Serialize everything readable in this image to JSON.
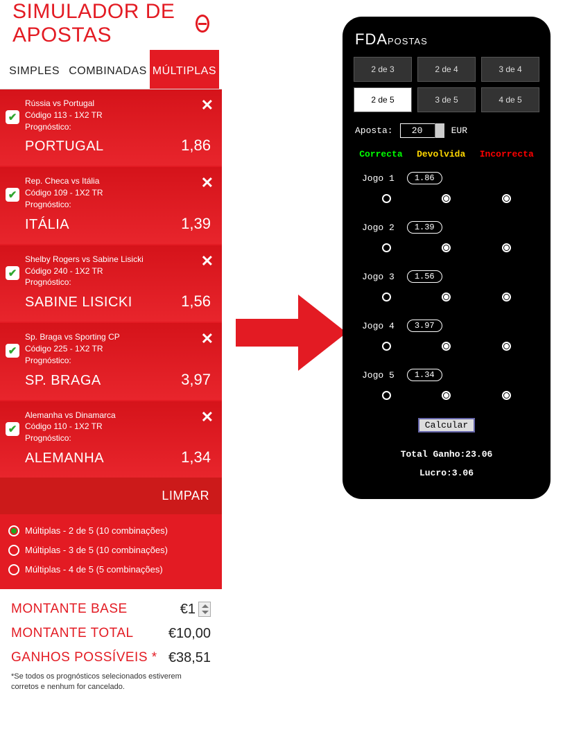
{
  "left": {
    "title": "SIMULADOR DE APOSTAS",
    "tabs": [
      "SIMPLES",
      "COMBINADAS",
      "MÚLTIPLAS"
    ],
    "picks": [
      {
        "match": "Rússia vs Portugal",
        "code": "Código 113 - 1X2 TR",
        "prog": "Prognóstico:",
        "selection": "PORTUGAL",
        "odd": "1,86"
      },
      {
        "match": "Rep. Checa vs Itália",
        "code": "Código 109 - 1X2 TR",
        "prog": "Prognóstico:",
        "selection": "ITÁLIA",
        "odd": "1,39"
      },
      {
        "match": "Shelby Rogers vs Sabine Lisicki",
        "code": "Código 240 - 1X2 TR",
        "prog": "Prognóstico:",
        "selection": "SABINE LISICKI",
        "odd": "1,56"
      },
      {
        "match": "Sp. Braga vs Sporting CP",
        "code": "Código 225 - 1X2 TR",
        "prog": "Prognóstico:",
        "selection": "SP. BRAGA",
        "odd": "3,97"
      },
      {
        "match": "Alemanha vs Dinamarca",
        "code": "Código 110 - 1X2 TR",
        "prog": "Prognóstico:",
        "selection": "ALEMANHA",
        "odd": "1,34"
      }
    ],
    "clear": "LIMPAR",
    "mult_options": [
      "Múltiplas - 2 de 5 (10 combinações)",
      "Múltiplas - 3 de 5 (10 combinações)",
      "Múltiplas - 4 de 5 (5 combinações)"
    ],
    "totals": {
      "base_label": "MONTANTE BASE",
      "base_val": "€1",
      "total_label": "MONTANTE TOTAL",
      "total_val": "€10,00",
      "gain_label": "GANHOS POSSÍVEIS *",
      "gain_val": "€38,51"
    },
    "footnote": "*Se todos os prognósticos selecionados estiverem corretos e nenhum for cancelado."
  },
  "right": {
    "logo_a": "FDA",
    "logo_b": "POSTAS",
    "grid": [
      "2 de 3",
      "2 de 4",
      "3 de 4",
      "2 de 5",
      "3 de 5",
      "4 de 5"
    ],
    "grid_selected": 3,
    "aposta_label": "Aposta:",
    "aposta_val": "20",
    "aposta_cur": "EUR",
    "hdr_c": "Correcta",
    "hdr_d": "Devolvida",
    "hdr_i": "Incorrecta",
    "games": [
      {
        "label": "Jogo 1",
        "odd": "1.86",
        "sel": 0
      },
      {
        "label": "Jogo 2",
        "odd": "1.39",
        "sel": 0
      },
      {
        "label": "Jogo 3",
        "odd": "1.56",
        "sel": 0
      },
      {
        "label": "Jogo 4",
        "odd": "3.97",
        "sel": 0
      },
      {
        "label": "Jogo 5",
        "odd": "1.34",
        "sel": 0
      }
    ],
    "calc": "Calcular",
    "total_ganho": "Total Ganho:23.06",
    "lucro": "Lucro:3.06"
  }
}
